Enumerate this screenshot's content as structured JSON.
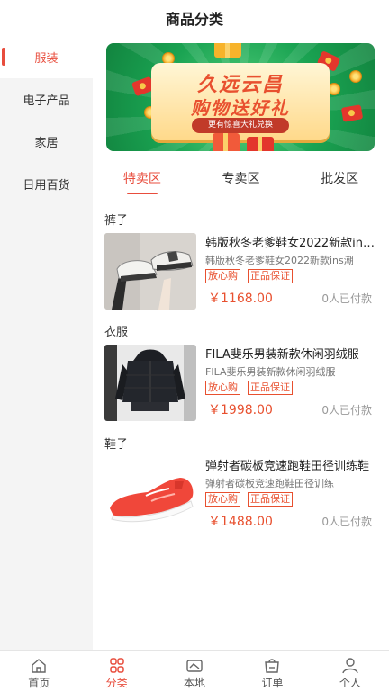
{
  "header": {
    "title": "商品分类"
  },
  "sidebar": {
    "items": [
      {
        "label": "服装",
        "active": true
      },
      {
        "label": "电子产品",
        "active": false
      },
      {
        "label": "家居",
        "active": false
      },
      {
        "label": "日用百货",
        "active": false
      }
    ]
  },
  "banner": {
    "line1": "久远云昌",
    "line2": "购物送好礼",
    "pill": "更有惊喜大礼兑换"
  },
  "tabs": [
    {
      "label": "特卖区",
      "active": true
    },
    {
      "label": "专卖区",
      "active": false
    },
    {
      "label": "批发区",
      "active": false
    }
  ],
  "sections": [
    {
      "title": "裤子",
      "product": {
        "name": "韩版秋冬老爹鞋女2022新款ins潮",
        "desc": "韩版秋冬老爹鞋女2022新款ins潮",
        "tags": [
          "放心购",
          "正品保证"
        ],
        "price": "￥1168.00",
        "sold": "0人已付款"
      }
    },
    {
      "title": "衣服",
      "product": {
        "name": "FILA斐乐男装新款休闲羽绒服",
        "desc": "FILA斐乐男装新款休闲羽绒服",
        "tags": [
          "放心购",
          "正品保证"
        ],
        "price": "￥1998.00",
        "sold": "0人已付款"
      }
    },
    {
      "title": "鞋子",
      "product": {
        "name": "弹射者碳板竞速跑鞋田径训练鞋",
        "desc": "弹射者碳板竞速跑鞋田径训练",
        "tags": [
          "放心购",
          "正品保证"
        ],
        "price": "￥1488.00",
        "sold": "0人已付款"
      }
    }
  ],
  "bottom_nav": [
    {
      "label": "首页",
      "icon": "home-icon",
      "active": false
    },
    {
      "label": "分类",
      "icon": "category-icon",
      "active": true
    },
    {
      "label": "本地",
      "icon": "local-icon",
      "active": false
    },
    {
      "label": "订单",
      "icon": "order-icon",
      "active": false
    },
    {
      "label": "个人",
      "icon": "person-icon",
      "active": false
    }
  ],
  "colors": {
    "accent": "#e84d3d",
    "sidebar_bg": "#f4f4f4",
    "banner_green": "#1aa352"
  }
}
